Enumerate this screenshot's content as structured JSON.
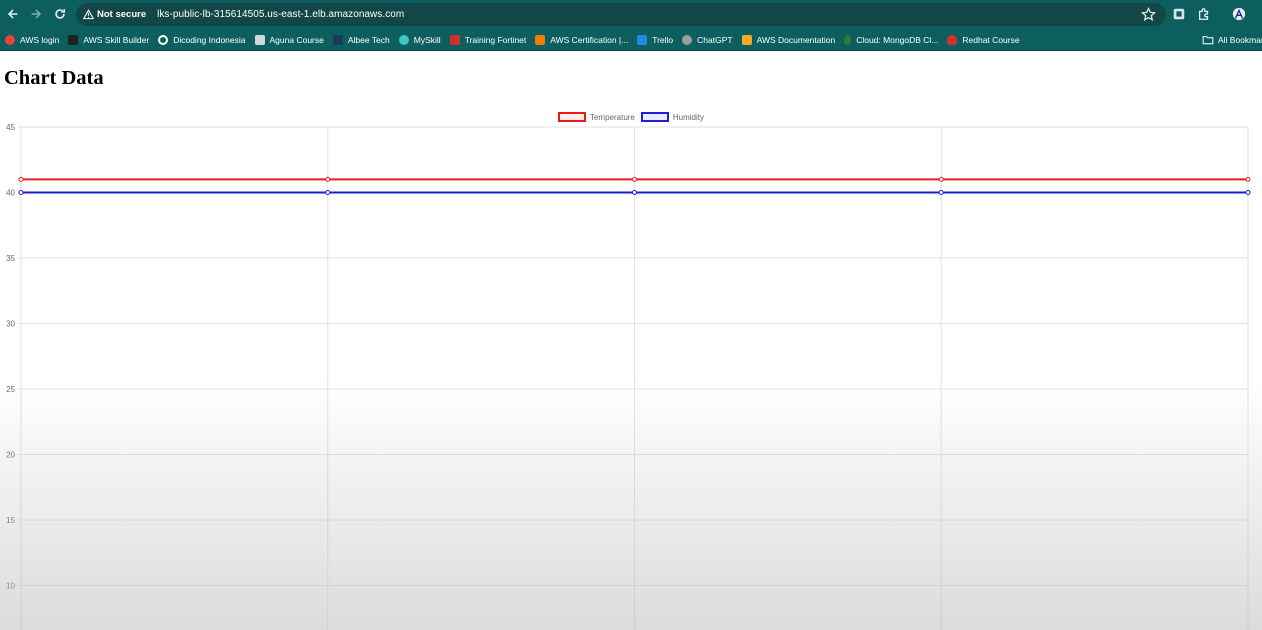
{
  "browser": {
    "security_label": "Not secure",
    "url": "lks-public-lb-315614505.us-east-1.elb.amazonaws.com",
    "bookmarks": [
      {
        "label": "AWS login",
        "icon": "aws-login-icon",
        "color": "#e8433a"
      },
      {
        "label": "AWS Skill Builder",
        "icon": "aws-skill-builder-icon",
        "color": "#222222"
      },
      {
        "label": "Dicoding Indonesia",
        "icon": "dicoding-icon",
        "color": "#ffffff"
      },
      {
        "label": "Aguna Course",
        "icon": "aguna-icon",
        "color": "#cfd8dc"
      },
      {
        "label": "Albee Tech",
        "icon": "albee-icon",
        "color": "#1b3a5c"
      },
      {
        "label": "MySkill",
        "icon": "myskill-icon",
        "color": "#3ec6c6"
      },
      {
        "label": "Training Fortinet",
        "icon": "fortinet-icon",
        "color": "#d32f2f"
      },
      {
        "label": "AWS Certification |...",
        "icon": "aws-cert-icon",
        "color": "#f57c00"
      },
      {
        "label": "Trello",
        "icon": "trello-icon",
        "color": "#1e88e5"
      },
      {
        "label": "ChatGPT",
        "icon": "chatgpt-icon",
        "color": "#9e9e9e"
      },
      {
        "label": "AWS Documentation",
        "icon": "aws-docs-icon",
        "color": "#f9a825"
      },
      {
        "label": "Cloud: MongoDB Cl...",
        "icon": "mongodb-icon",
        "color": "#2e7d32"
      },
      {
        "label": "Redhat Course",
        "icon": "redhat-icon",
        "color": "#d32f2f"
      }
    ],
    "all_bookmarks_label": "All Bookmarks"
  },
  "page": {
    "title": "Chart Data"
  },
  "chart_data": {
    "type": "line",
    "x": [
      "",
      "",
      "",
      "",
      ""
    ],
    "series": [
      {
        "name": "Temperature",
        "values": [
          41,
          41,
          41,
          41,
          41
        ],
        "color": "#e31c1c"
      },
      {
        "name": "Humidity",
        "values": [
          40,
          40,
          40,
          40,
          40
        ],
        "color": "#1c1ce3"
      }
    ],
    "yticks": [
      45,
      40,
      35,
      30,
      25,
      20,
      15,
      10
    ],
    "ylim": [
      10,
      45
    ],
    "grid": true,
    "legend": "top-center"
  }
}
